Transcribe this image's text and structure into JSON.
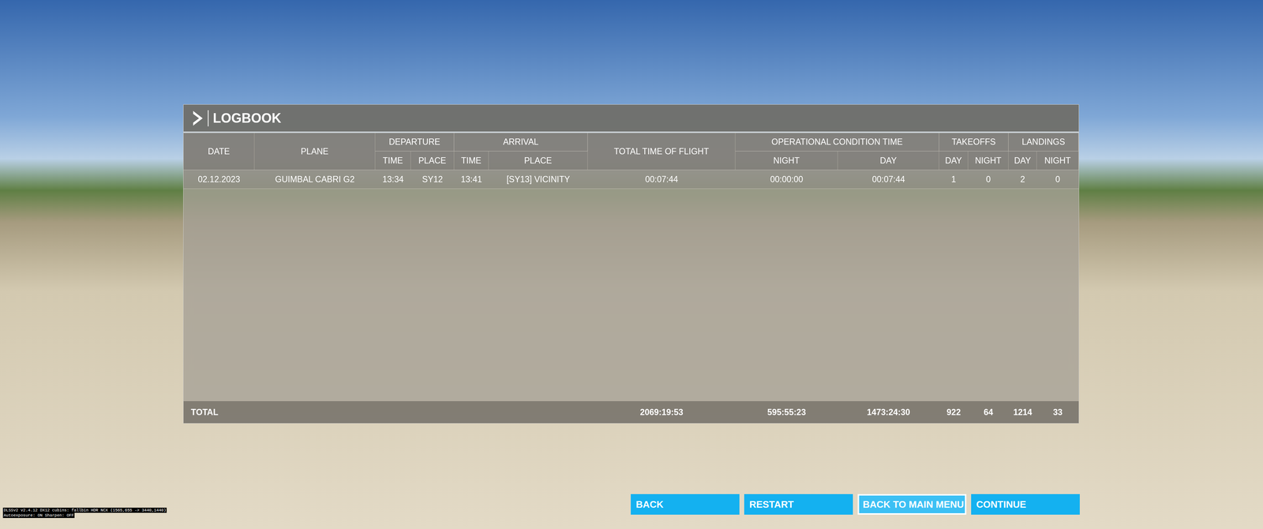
{
  "logbook": {
    "title": "LOGBOOK"
  },
  "columns": [
    {
      "label": "DATE",
      "sub": []
    },
    {
      "label": "PLANE",
      "sub": []
    },
    {
      "label": "DEPARTURE",
      "sub": [
        "TIME",
        "PLACE"
      ]
    },
    {
      "label": "ARRIVAL",
      "sub": [
        "TIME",
        "PLACE"
      ]
    },
    {
      "label": "TOTAL TIME OF FLIGHT",
      "sub": []
    },
    {
      "label": "OPERATIONAL CONDITION TIME",
      "sub": [
        "NIGHT",
        "DAY"
      ]
    },
    {
      "label": "TAKEOFFS",
      "sub": [
        "DAY",
        "NIGHT"
      ]
    },
    {
      "label": "LANDINGS",
      "sub": [
        "DAY",
        "NIGHT"
      ]
    }
  ],
  "rows": [
    [
      "02.12.2023",
      "GUIMBAL CABRI G2",
      "13:34",
      "SY12",
      "13:41",
      "[SY13] VICINITY",
      "00:07:44",
      "00:00:00",
      "00:07:44",
      "1",
      "0",
      "2",
      "0"
    ]
  ],
  "totals": {
    "label": "TOTAL",
    "values": [
      "2069:19:53",
      "595:55:23",
      "1473:24:30",
      "922",
      "64",
      "1214",
      "33"
    ]
  },
  "buttons": [
    {
      "label": "BACK",
      "selected": false
    },
    {
      "label": "RESTART",
      "selected": false
    },
    {
      "label": "BACK TO MAIN MENU",
      "selected": true
    },
    {
      "label": "CONTINUE",
      "selected": false
    }
  ],
  "debug_overlay": [
    "DLSSv2 v2.4.12 DX12 cubins: fallbin HDR NCX (1565,655 -> 3440,1440)",
    "Autoexposure: ON Sharpen: OFF"
  ]
}
